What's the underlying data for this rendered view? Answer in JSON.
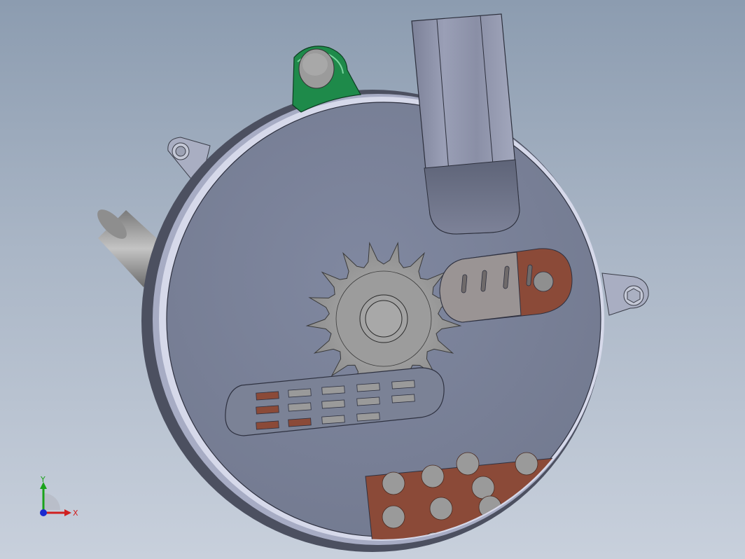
{
  "viewport": {
    "background_top": "#8c9cb0",
    "background_bottom": "#c8d0dc"
  },
  "model": {
    "housing_color": "#7b8296",
    "rim_color": "#c9cde6",
    "copper_color": "#8b4a38",
    "bracket_color": "#1e8a4a",
    "steel_color": "#9a9a9a"
  },
  "triad": {
    "y_label": "Y",
    "x_label": "X",
    "y_color": "#1aa31a",
    "x_color": "#d02020",
    "z_color": "#1a2ad0"
  }
}
